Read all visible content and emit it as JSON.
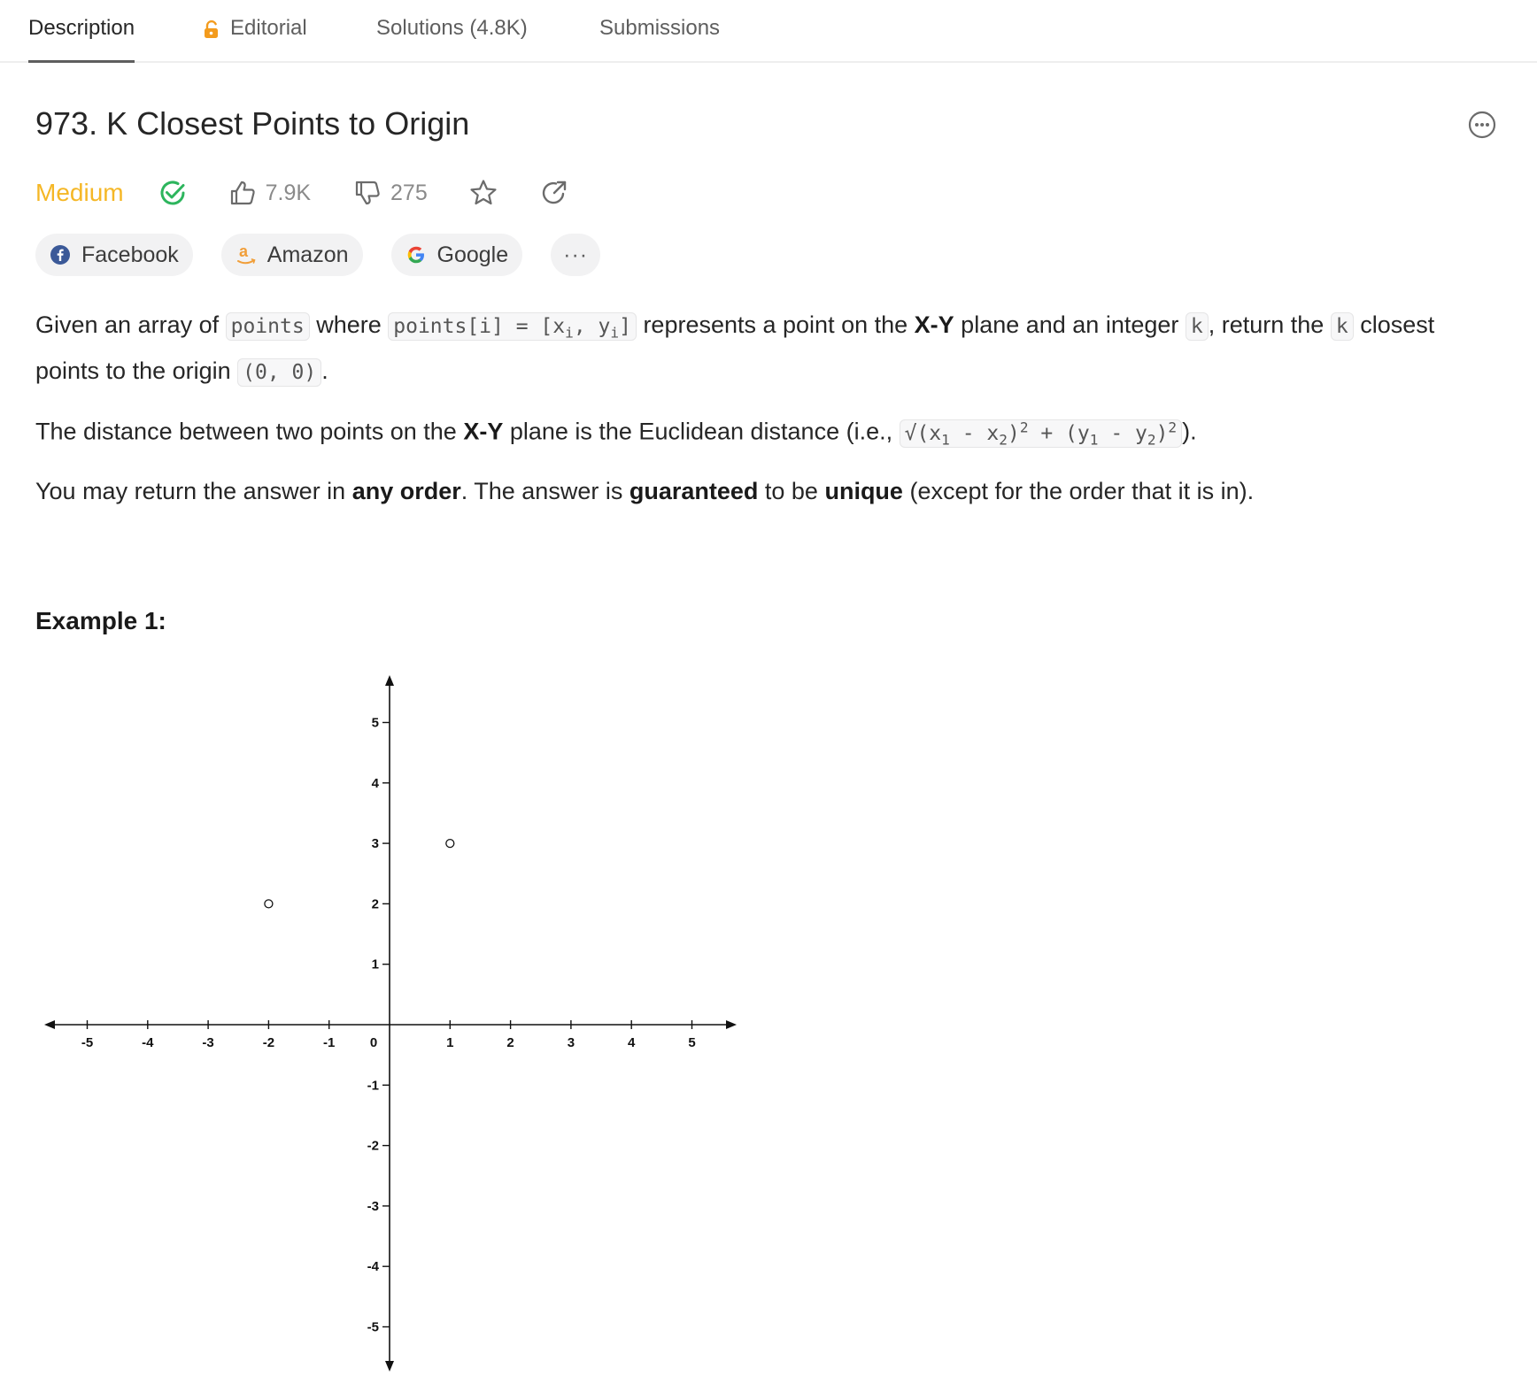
{
  "tabs": [
    {
      "label": "Description"
    },
    {
      "label": "Editorial"
    },
    {
      "label": "Solutions (4.8K)"
    },
    {
      "label": "Submissions"
    }
  ],
  "problem": {
    "title": "973. K Closest Points to Origin",
    "difficulty": "Medium",
    "likes": "7.9K",
    "dislikes": "275"
  },
  "companies": [
    {
      "label": "Facebook"
    },
    {
      "label": "Amazon"
    },
    {
      "label": "Google"
    }
  ],
  "companies_more": "···",
  "description": {
    "p1": {
      "t1": "Given an array of ",
      "c1": "points",
      "t2": " where ",
      "c2a": "points[i] = [x",
      "c2sub1": "i",
      "c2b": ", y",
      "c2sub2": "i",
      "c2c": "]",
      "t3": " represents a point on the ",
      "b1": "X-Y",
      "t4": " plane and an integer ",
      "c3": "k",
      "t5": ", return the ",
      "c4": "k",
      "t6": " closest points to the origin ",
      "c5": "(0, 0)",
      "t7": "."
    },
    "p2": {
      "t1": "The distance between two points on the ",
      "b1": "X-Y",
      "t2": " plane is the Euclidean distance (i.e., ",
      "c_a": "√(x",
      "c_sub1": "1",
      "c_b": " - x",
      "c_sub2": "2",
      "c_c": ")",
      "c_sup1": "2",
      "c_d": " + (y",
      "c_sub3": "1",
      "c_e": " - y",
      "c_sub4": "2",
      "c_f": ")",
      "c_sup2": "2",
      "t3": ")."
    },
    "p3": {
      "t1": "You may return the answer in ",
      "b1": "any order",
      "t2": ". The answer is ",
      "b2": "guaranteed",
      "t3": " to be ",
      "b3": "unique",
      "t4": " (except for the order that it is in)."
    }
  },
  "example_title": "Example 1:",
  "chart_data": {
    "type": "scatter",
    "xlim": [
      -5,
      5
    ],
    "ylim": [
      -5,
      5
    ],
    "x_ticks": [
      "-5",
      "-4",
      "-3",
      "-2",
      "-1",
      "0",
      "1",
      "2",
      "3",
      "4",
      "5"
    ],
    "y_ticks": [
      "5",
      "4",
      "3",
      "2",
      "1",
      "-1",
      "-2",
      "-3",
      "-4",
      "-5"
    ],
    "points": [
      {
        "x": 1,
        "y": 3
      },
      {
        "x": -2,
        "y": 2
      }
    ],
    "grid": false,
    "marker": "open-circle"
  },
  "colors": {
    "difficulty_medium": "#f5b726",
    "solved_check": "#2db55d",
    "editorial_lock": "#f39b1d",
    "facebook": "#3b5998",
    "amazon": "#f19e38"
  }
}
